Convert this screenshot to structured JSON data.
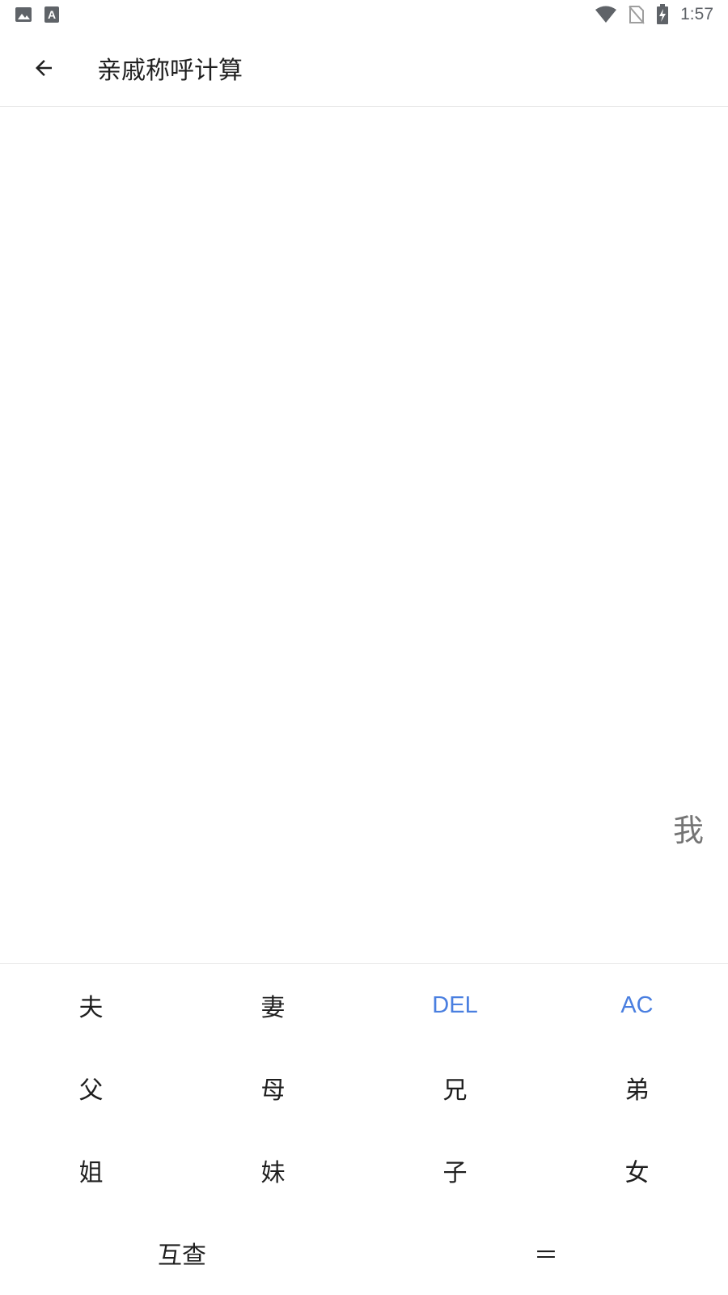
{
  "status_bar": {
    "time": "1:57",
    "icons_left": [
      "image-icon",
      "text-a-icon"
    ],
    "icons_right": [
      "wifi-icon",
      "no-sim-icon",
      "battery-charging-icon"
    ]
  },
  "app_bar": {
    "title": "亲戚称呼计算",
    "back_icon": "arrow-left-icon"
  },
  "display": {
    "expression": "我"
  },
  "keypad": {
    "row1": [
      "夫",
      "妻",
      "DEL",
      "AC"
    ],
    "row2": [
      "父",
      "母",
      "兄",
      "弟"
    ],
    "row3": [
      "姐",
      "妹",
      "子",
      "女"
    ],
    "row4": [
      "互查",
      "＝"
    ]
  },
  "colors": {
    "accent": "#4a7fe0",
    "expression": "#757575",
    "status_icons": "#5f6368"
  }
}
